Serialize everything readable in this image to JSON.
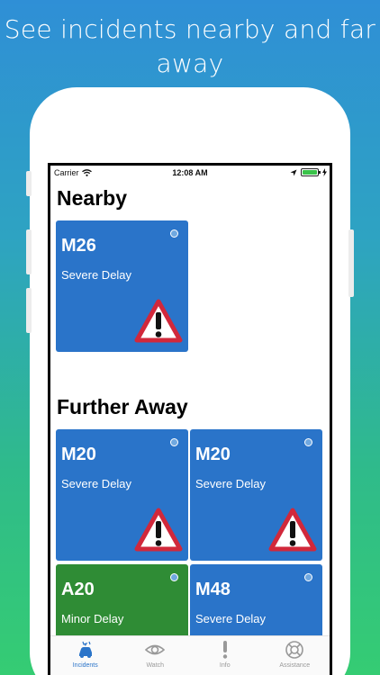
{
  "headline": "See incidents nearby and far away",
  "status_bar": {
    "carrier": "Carrier",
    "time": "12:08 AM"
  },
  "sections": {
    "nearby": "Nearby",
    "further": "Further Away"
  },
  "cards": [
    {
      "road": "M26",
      "status": "Severe Delay",
      "color": "#2a74c9",
      "warning": true
    },
    {
      "road": "M20",
      "status": "Severe Delay",
      "color": "#2a74c9",
      "warning": true
    },
    {
      "road": "M20",
      "status": "Severe Delay",
      "color": "#2a74c9",
      "warning": true
    },
    {
      "road": "A20",
      "status": "Minor Delay",
      "color": "#2f8c35",
      "warning": false
    },
    {
      "road": "M48",
      "status": "Severe Delay",
      "color": "#2a74c9",
      "warning": false
    }
  ],
  "tabs": [
    {
      "label": "Incidents",
      "icon": "car-crash-icon",
      "active": true
    },
    {
      "label": "Watch",
      "icon": "eye-icon",
      "active": false
    },
    {
      "label": "Info",
      "icon": "exclamation-icon",
      "active": false
    },
    {
      "label": "Assistance",
      "icon": "lifebuoy-icon",
      "active": false
    }
  ]
}
